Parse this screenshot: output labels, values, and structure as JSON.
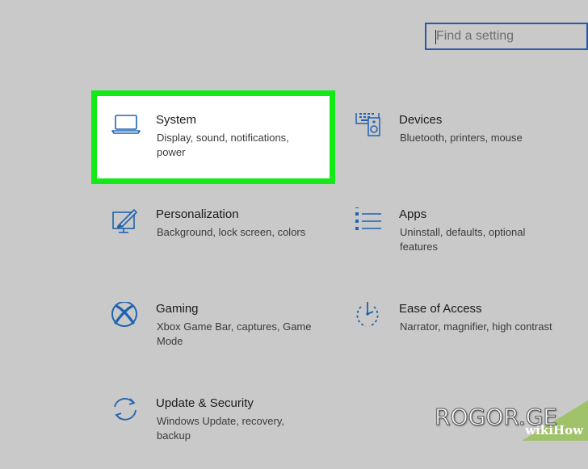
{
  "search": {
    "placeholder": "Find a setting"
  },
  "tiles": [
    {
      "title": "System",
      "desc": "Display, sound, notifications, power",
      "icon": "laptop-icon",
      "highlighted": true
    },
    {
      "title": "Devices",
      "desc": "Bluetooth, printers, mouse",
      "icon": "keyboard-speaker-icon"
    },
    {
      "title": "Personalization",
      "desc": "Background, lock screen, colors",
      "icon": "paintbrush-monitor-icon"
    },
    {
      "title": "Apps",
      "desc": "Uninstall, defaults, optional features",
      "icon": "apps-list-icon"
    },
    {
      "title": "Gaming",
      "desc": "Xbox Game Bar, captures, Game Mode",
      "icon": "xbox-icon"
    },
    {
      "title": "Ease of Access",
      "desc": "Narrator, magnifier, high contrast",
      "icon": "ease-of-access-icon"
    },
    {
      "title": "Update & Security",
      "desc": "Windows Update, recovery, backup",
      "icon": "sync-arrows-icon"
    }
  ],
  "watermark": {
    "text": "ROGOR.GE",
    "badge": "wikiHow"
  },
  "colors": {
    "background": "#c9c9c9",
    "accent_blue": "#1f63b0",
    "highlight_green": "#13ea17",
    "text_dark": "#1a1a1a"
  }
}
